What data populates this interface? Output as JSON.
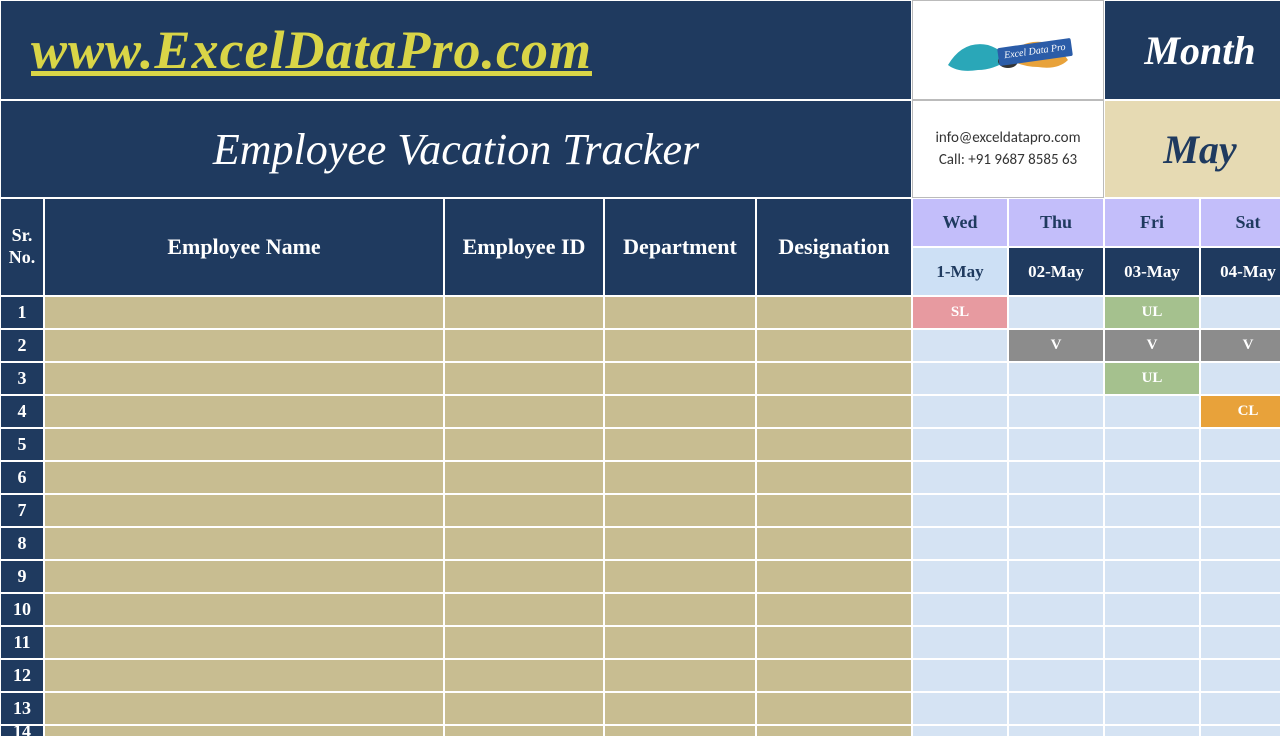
{
  "banner": {
    "url_text": "www.ExcelDataPro.com",
    "title": "Employee Vacation Tracker",
    "logo_label": "Excel Data Pro",
    "contact_email": "info@exceldatapro.com",
    "contact_phone": "Call: +91 9687 8585 63",
    "month_label": "Month",
    "month_value": "May"
  },
  "columns": {
    "sr": "Sr. No.",
    "name": "Employee Name",
    "id": "Employee ID",
    "dept": "Department",
    "desig": "Designation"
  },
  "calendar": {
    "days": [
      "Wed",
      "Thu",
      "Fri",
      "Sat"
    ],
    "dates": [
      "1-May",
      "02-May",
      "03-May",
      "04-May"
    ],
    "highlight_date_index": 0
  },
  "rows": [
    {
      "num": "1",
      "cells": [
        "SL",
        "",
        "UL",
        ""
      ]
    },
    {
      "num": "2",
      "cells": [
        "",
        "V",
        "V",
        "V"
      ]
    },
    {
      "num": "3",
      "cells": [
        "",
        "",
        "UL",
        ""
      ]
    },
    {
      "num": "4",
      "cells": [
        "",
        "",
        "",
        "CL"
      ]
    },
    {
      "num": "5",
      "cells": [
        "",
        "",
        "",
        ""
      ]
    },
    {
      "num": "6",
      "cells": [
        "",
        "",
        "",
        ""
      ]
    },
    {
      "num": "7",
      "cells": [
        "",
        "",
        "",
        ""
      ]
    },
    {
      "num": "8",
      "cells": [
        "",
        "",
        "",
        ""
      ]
    },
    {
      "num": "9",
      "cells": [
        "",
        "",
        "",
        ""
      ]
    },
    {
      "num": "10",
      "cells": [
        "",
        "",
        "",
        ""
      ]
    },
    {
      "num": "11",
      "cells": [
        "",
        "",
        "",
        ""
      ]
    },
    {
      "num": "12",
      "cells": [
        "",
        "",
        "",
        ""
      ]
    },
    {
      "num": "13",
      "cells": [
        "",
        "",
        "",
        ""
      ]
    },
    {
      "num": "14",
      "cells": [
        "",
        "",
        "",
        ""
      ]
    }
  ]
}
